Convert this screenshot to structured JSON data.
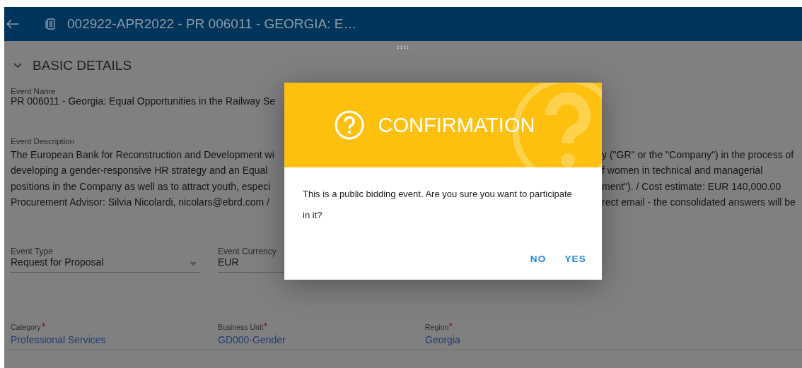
{
  "header": {
    "title": "002922-APR2022 - PR 006011 - GEORGIA: E…"
  },
  "section": {
    "title": "BASIC DETAILS",
    "expanded": true
  },
  "event_name": {
    "label": "Event Name",
    "value": "PR 006011 - Georgia: Equal Opportunities in the Railway Se"
  },
  "event_description": {
    "label": "Event Description",
    "lines": [
      {
        "left": "The European Bank for Reconstruction and Development wi",
        "right": "y (\"GR\" or the \"Company\") in the process of"
      },
      {
        "left": "developing a gender-responsive HR strategy and an Equal",
        "right": "f women in technical and managerial"
      },
      {
        "left": "positions in the Company as well as to attract youth, especi",
        "right": "ment\"). / Cost estimate: EUR 140,000.00"
      },
      {
        "left": "Procurement Advisor: Silvia Nicolardi, nicolars@ebrd.com /",
        "right": "rect email - the consolidated answers will be"
      }
    ]
  },
  "select_fields": [
    {
      "label": "Event Type",
      "value": "Request for Proposal",
      "kind": "dropdown"
    },
    {
      "label": "Event Currency",
      "value": "EUR",
      "kind": "text"
    }
  ],
  "required_fields": [
    {
      "label": "Category",
      "value": "Professional Services",
      "required": true
    },
    {
      "label": "Business Unit",
      "value": "GD000-Gender",
      "required": true
    },
    {
      "label": "Region",
      "value": "Georgia",
      "required": true
    }
  ],
  "dialog": {
    "title": "CONFIRMATION",
    "message": "This is a public bidding event. Are you sure you want to participate in it?",
    "buttons": [
      "NO",
      "YES"
    ]
  }
}
